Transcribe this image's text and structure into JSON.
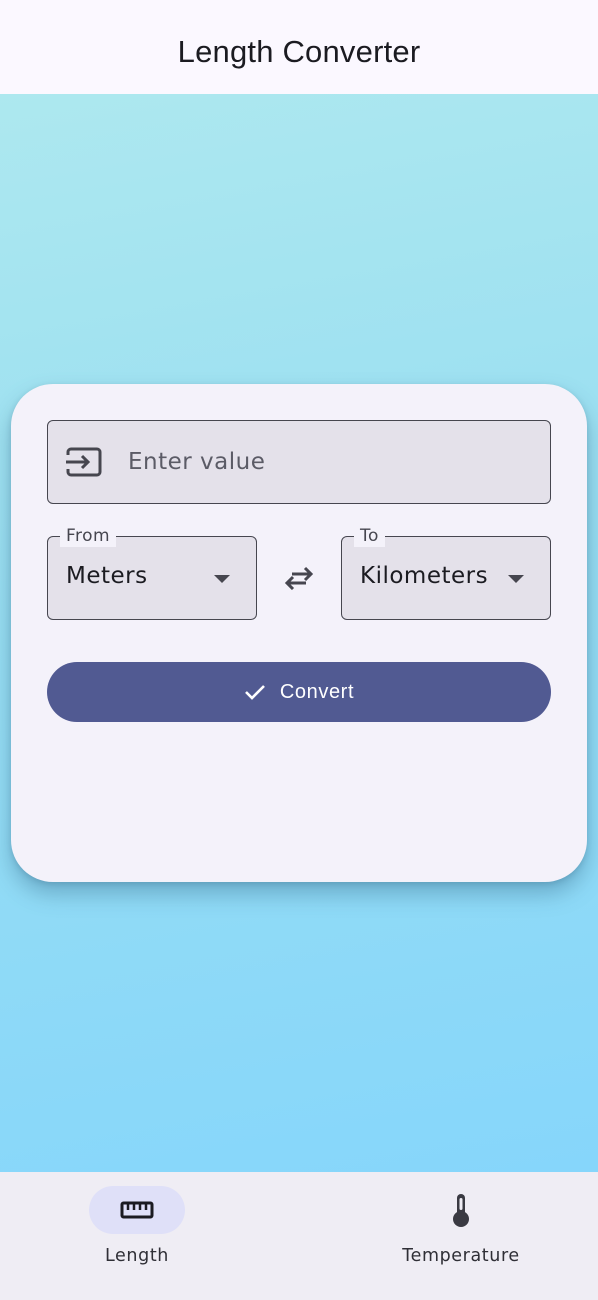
{
  "app_bar": {
    "title": "Length Converter"
  },
  "converter": {
    "value_input": {
      "placeholder": "Enter value",
      "value": "",
      "icon": "input-icon"
    },
    "from": {
      "label": "From",
      "selected": "Meters"
    },
    "to": {
      "label": "To",
      "selected": "Kilometers"
    },
    "swap_icon": "swap-horiz-icon",
    "convert_button": {
      "label": "Convert",
      "icon": "check-icon"
    }
  },
  "bottom_nav": {
    "items": [
      {
        "label": "Length",
        "icon": "ruler-icon",
        "selected": true
      },
      {
        "label": "Temperature",
        "icon": "thermometer-icon",
        "selected": false
      }
    ]
  },
  "colors": {
    "primary": "#515a92",
    "surface": "#f4f2fa",
    "nav_indicator": "#dfe0f8",
    "background_gradient_start": "#ade8ef",
    "background_gradient_end": "#86d6fb"
  }
}
